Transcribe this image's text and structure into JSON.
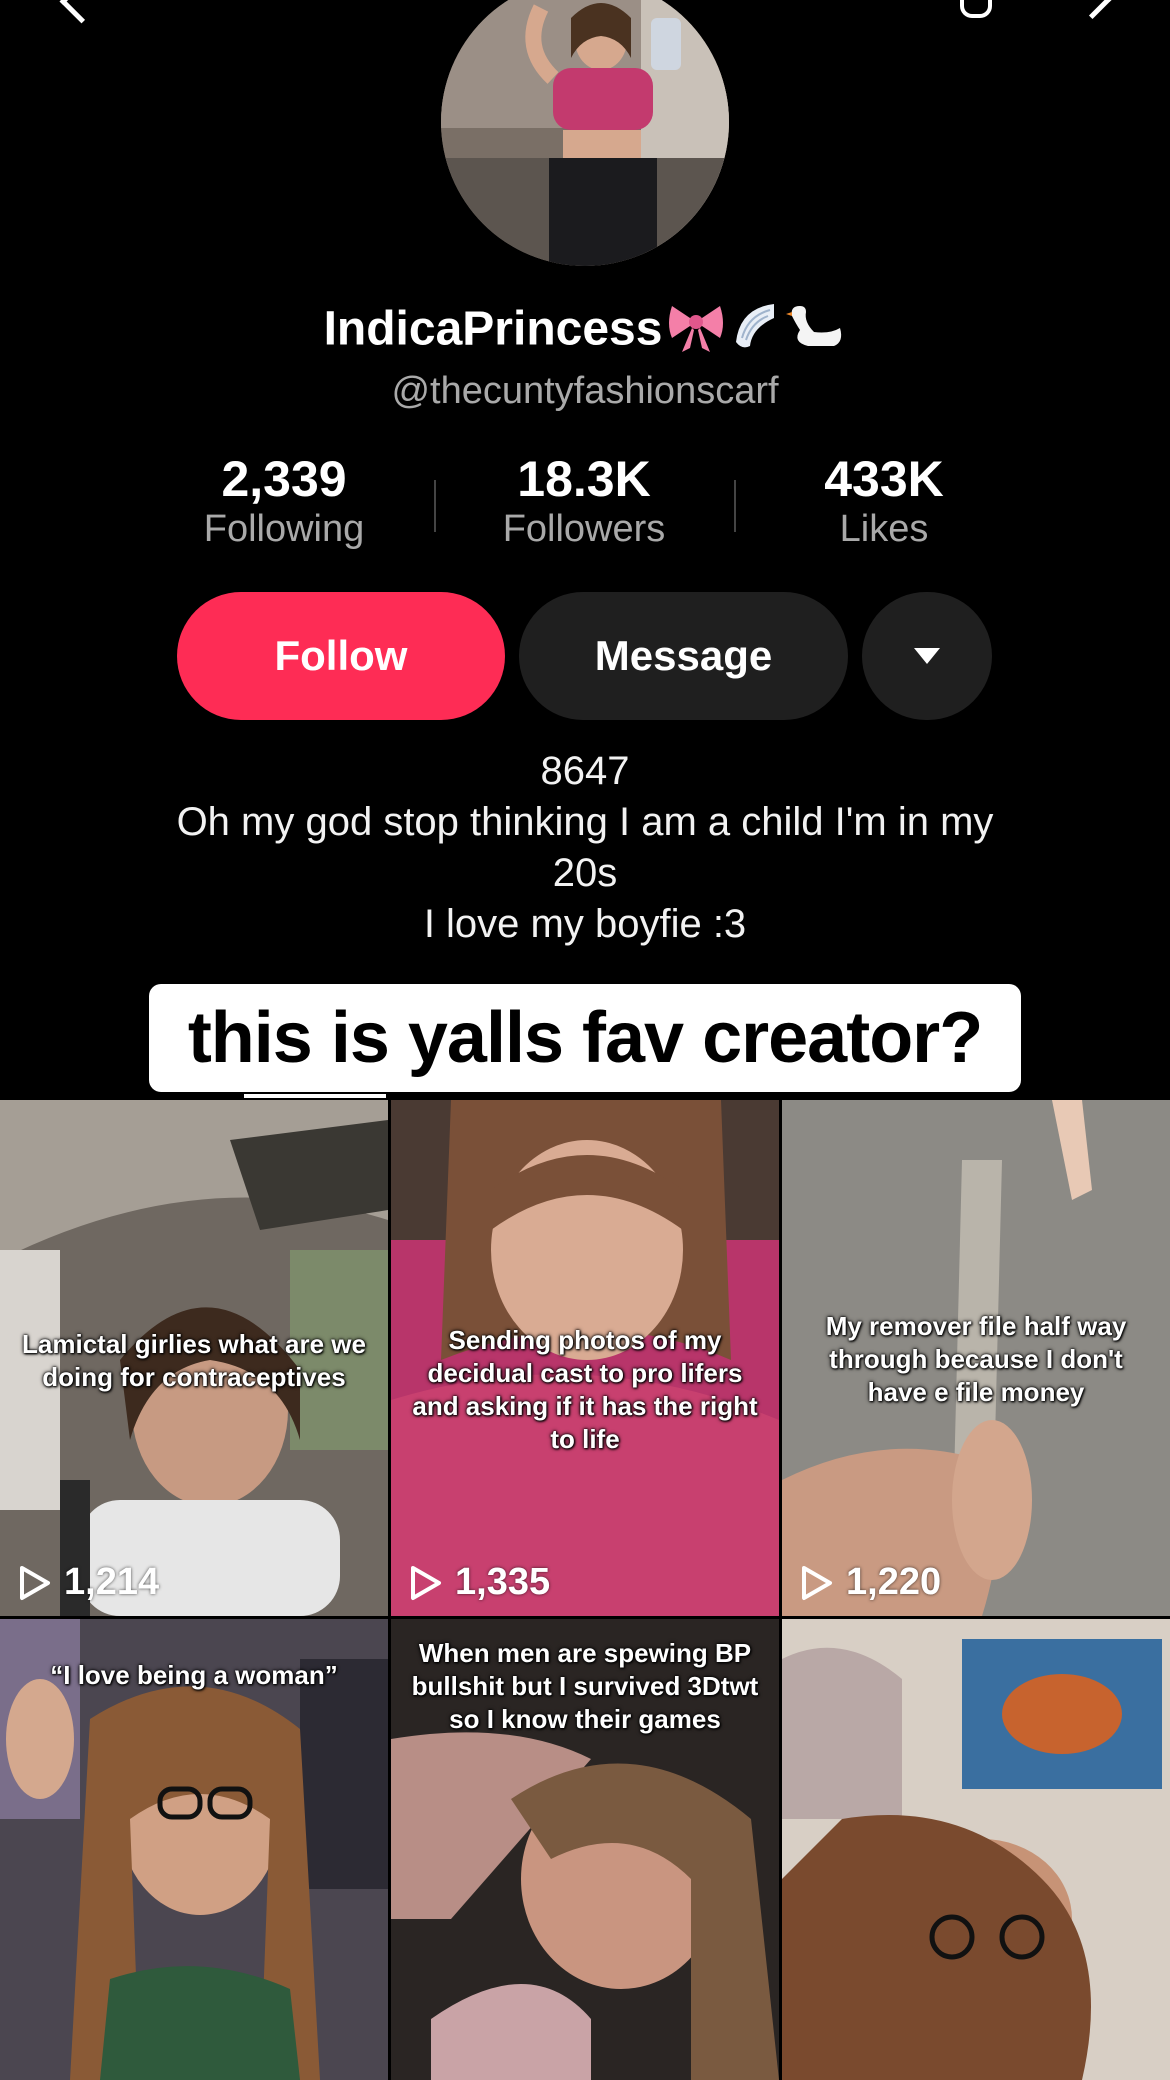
{
  "profile": {
    "display_name": "IndicaPrincess",
    "emojis": [
      "bow-emoji",
      "wing-emoji",
      "swan-emoji"
    ],
    "handle": "@thecuntyfashionscarf"
  },
  "stats": [
    {
      "value": "2,339",
      "label": "Following"
    },
    {
      "value": "18.3K",
      "label": "Followers"
    },
    {
      "value": "433K",
      "label": "Likes"
    }
  ],
  "actions": {
    "follow_label": "Follow",
    "message_label": "Message",
    "more_icon": "triangle-down-icon"
  },
  "bio": {
    "lines": [
      "8647",
      "Oh my god stop thinking I am a child I'm in my",
      "20s",
      "I love my boyfie :3"
    ]
  },
  "overlay_caption": "this is yalls fav creator?",
  "videos": [
    {
      "caption": "Lamictal girlies what are we doing for contraceptives",
      "views": "1,214"
    },
    {
      "caption": "Sending photos of my decidual cast to pro lifers and asking if it has the right to life",
      "views": "1,335"
    },
    {
      "caption": "My remover file half way through because I don't have e file money",
      "views": "1,220"
    },
    {
      "caption": "“I love being a woman”",
      "views": ""
    },
    {
      "caption": "When men are spewing BP bullshit but I survived 3Dtwt so I know their games",
      "views": ""
    },
    {
      "caption": "",
      "views": ""
    }
  ],
  "colors": {
    "background": "#000000",
    "follow_button": "#fe2c55",
    "secondary_button": "#1f1f1f",
    "muted_text": "#a9a9a9"
  }
}
